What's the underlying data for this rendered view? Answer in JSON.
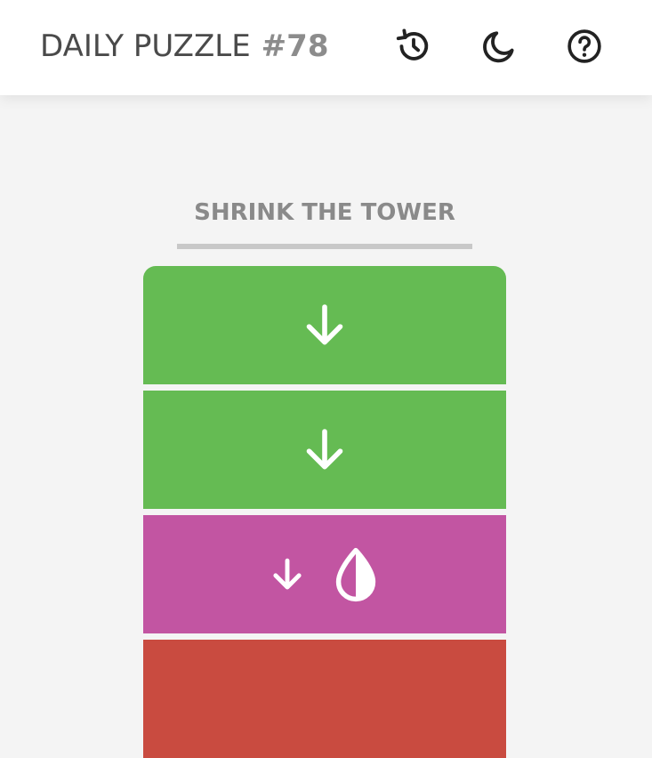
{
  "header": {
    "title": "DAILY PUZZLE",
    "puzzle_number": "#78",
    "icons": [
      "history-icon",
      "moon-icon",
      "help-icon"
    ]
  },
  "game": {
    "instruction": "SHRINK THE TOWER",
    "blocks": [
      {
        "color": "#65bb53",
        "icons": [
          "arrow-down-icon"
        ]
      },
      {
        "color": "#65bb53",
        "icons": [
          "arrow-down-icon"
        ]
      },
      {
        "color": "#c255a2",
        "icons": [
          "arrow-down-icon",
          "half-drop-icon"
        ]
      },
      {
        "color": "#c94b40",
        "icons": []
      }
    ]
  },
  "colors": {
    "background": "#f4f4f4",
    "header_bg": "#ffffff",
    "text_dark": "#4a4a4a",
    "text_muted": "#8a8a8a",
    "green": "#65bb53",
    "magenta": "#c255a2",
    "red": "#c94b40"
  }
}
